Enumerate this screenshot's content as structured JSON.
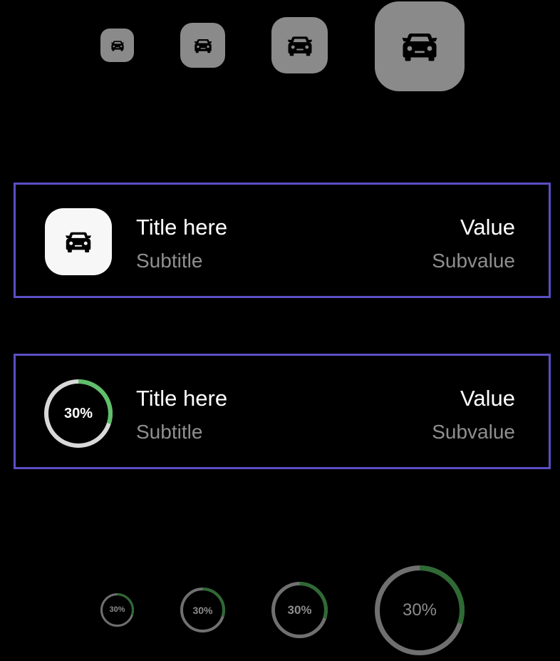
{
  "icon_tiles": {
    "icon": "car-icon",
    "background": "#8a8a8a",
    "icon_color": "#000000",
    "count": 4
  },
  "rows": [
    {
      "leading": "car-icon-tile",
      "title": "Title here",
      "subtitle": "Subtitle",
      "value": "Value",
      "subvalue": "Subvalue"
    },
    {
      "leading": "progress-ring",
      "progress_label": "30%",
      "progress": 0.3,
      "title": "Title here",
      "subtitle": "Subtitle",
      "value": "Value",
      "subvalue": "Subvalue"
    }
  ],
  "progress_rings": {
    "label": "30%",
    "progress": 0.3,
    "count": 4
  },
  "colors": {
    "background": "#000000",
    "frame_border": "#5a4fc4",
    "progress_fill": "#5fbf6a",
    "progress_track": "#d9d9d9",
    "progress_fill_dim": "#2f6a35",
    "progress_track_dim": "#707070",
    "title_text": "#ffffff",
    "subtitle_text": "#8f8f8f"
  }
}
